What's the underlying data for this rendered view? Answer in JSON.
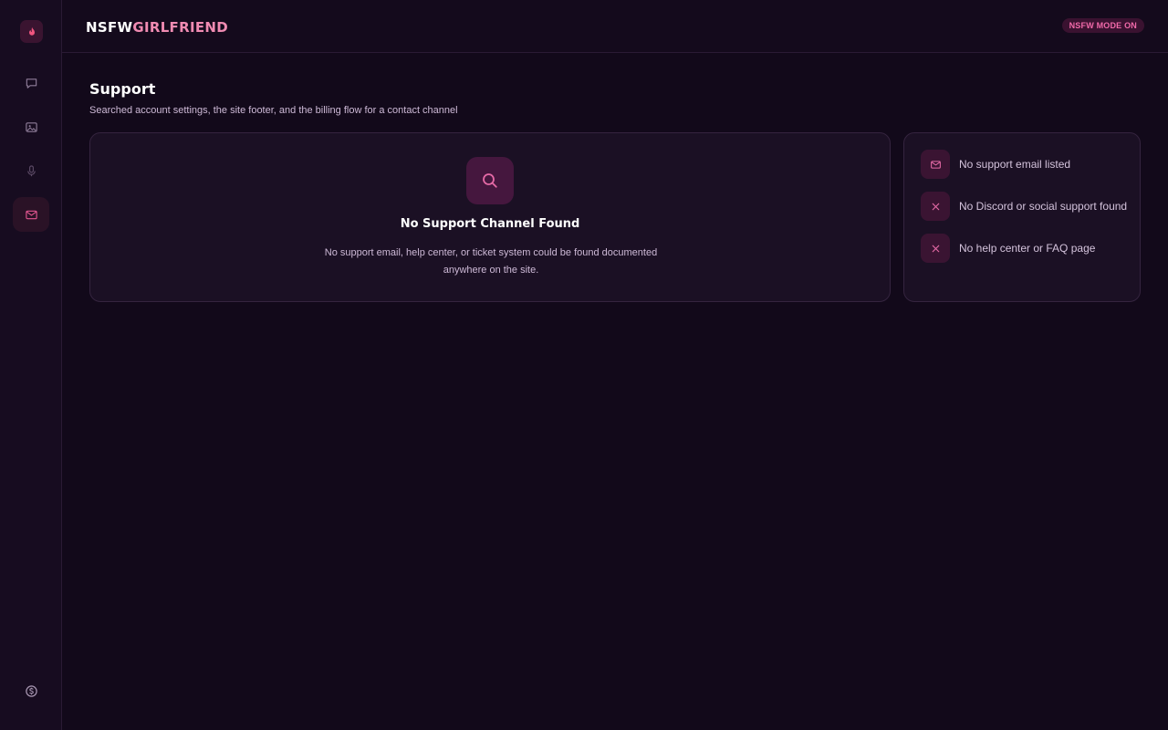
{
  "brand": {
    "part1": "NSFW",
    "part2": "GIRLFRIEND"
  },
  "badge": "NSFW MODE ON",
  "sidebar": {
    "items": [
      {
        "icon": "chat-icon"
      },
      {
        "icon": "image-icon"
      },
      {
        "icon": "microphone-icon"
      },
      {
        "icon": "mail-icon",
        "active": true
      }
    ],
    "bottom_icon": "dollar-coin-icon"
  },
  "page": {
    "title": "Support",
    "subtitle": "Searched account settings, the site footer, and the billing flow for a contact channel"
  },
  "result_card": {
    "icon": "search-icon",
    "title": "No Support Channel Found",
    "description": "No support email, help center, or ticket system could be found documented anywhere on the site."
  },
  "checklist": [
    {
      "icon": "mail-icon",
      "label": "No support email listed"
    },
    {
      "icon": "close-icon",
      "label": "No Discord or social support found"
    },
    {
      "icon": "close-icon",
      "label": "No help center or FAQ page"
    }
  ],
  "colors": {
    "accent": "#f26aaa",
    "background": "#12091a",
    "card": "#1b1024"
  }
}
